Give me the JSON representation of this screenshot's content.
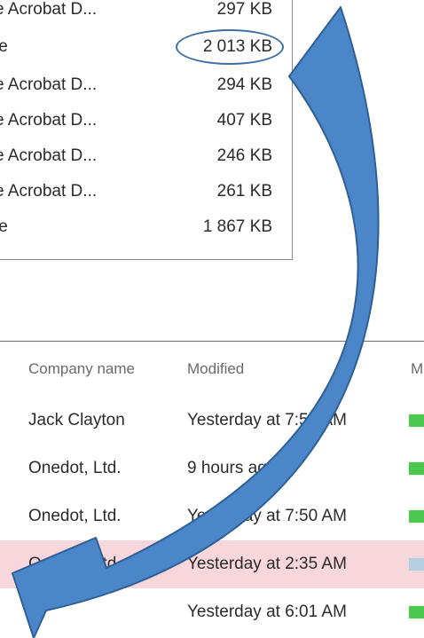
{
  "file_list": {
    "rows": [
      {
        "type": "e Acrobat D...",
        "size": "297 KB"
      },
      {
        "type": "le",
        "size": "2 013 KB"
      },
      {
        "type": "e Acrobat D...",
        "size": "294 KB"
      },
      {
        "type": "e Acrobat D...",
        "size": "407 KB"
      },
      {
        "type": "e Acrobat D...",
        "size": "246 KB"
      },
      {
        "type": "e Acrobat D...",
        "size": "261 KB"
      },
      {
        "type": "le",
        "size": "1 867 KB"
      }
    ]
  },
  "table": {
    "headers": {
      "company": "Company name",
      "modified": "Modified",
      "extra": "M"
    },
    "rows": [
      {
        "company": "Jack Clayton",
        "modified": "Yesterday at 7:50 AM",
        "status_color": "#4cc94c"
      },
      {
        "company": "Onedot, Ltd.",
        "modified": "9 hours ago",
        "status_color": "#4cc94c"
      },
      {
        "company": "Onedot, Ltd.",
        "modified": "Yesterday at 7:50 AM",
        "status_color": "#4cc94c"
      },
      {
        "company": "Onedot, Ltd.",
        "modified": "Yesterday at 2:35 AM",
        "status_color": "#b5cfe0",
        "selected": true
      },
      {
        "company": "",
        "modified": "Yesterday at 6:01 AM",
        "status_color": "#4cc94c"
      }
    ]
  },
  "annotation": {
    "highlight_color": "#3a6ea5",
    "arrow_fill": "#4a86c8",
    "arrow_stroke": "#2f5f95",
    "arrow_icon": "curved-arrow-icon",
    "ellipse_icon": "highlight-ellipse-icon"
  },
  "colors": {
    "selected_row": "#f7d7dc",
    "status_green": "#4cc94c",
    "status_blue": "#b5cfe0"
  }
}
